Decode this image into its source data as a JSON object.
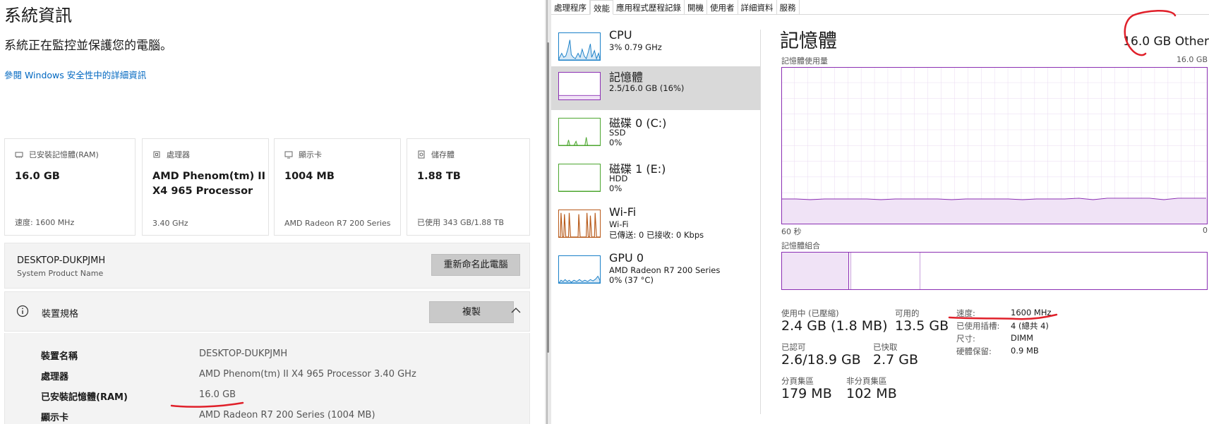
{
  "left": {
    "title": "系統資訊",
    "subtitle": "系統正在監控並保護您的電腦。",
    "link": "參閱 Windows 安全性中的詳細資訊",
    "cards": [
      {
        "icon": "ram-icon",
        "label": "已安裝記憶體(RAM)",
        "value": "16.0 GB",
        "value2": "",
        "footer": "速度: 1600 MHz"
      },
      {
        "icon": "processor-icon",
        "label": "處理器",
        "value": "AMD Phenom(tm) II",
        "value2": "X4 965 Processor",
        "footer": "3.40 GHz"
      },
      {
        "icon": "display-card-icon",
        "label": "顯示卡",
        "value": "1004 MB",
        "value2": "",
        "footer": "AMD Radeon R7 200 Series"
      },
      {
        "icon": "storage-icon",
        "label": "儲存體",
        "value": "1.88 TB",
        "value2": "",
        "footer": "已使用 343 GB/1.88 TB"
      }
    ],
    "device": {
      "name": "DESKTOP-DUKPJMH",
      "model": "System Product Name",
      "rename_button": "重新命名此電腦"
    },
    "specs": {
      "title": "裝置規格",
      "copy_button": "複製",
      "rows": [
        {
          "label": "裝置名稱",
          "value": "DESKTOP-DUKPJMH"
        },
        {
          "label": "處理器",
          "value": "AMD Phenom(tm) II X4 965 Processor   3.40 GHz"
        },
        {
          "label": "已安裝記憶體(RAM)",
          "value": "16.0 GB"
        },
        {
          "label": "顯示卡",
          "value": "AMD Radeon R7 200 Series (1004 MB)"
        }
      ]
    },
    "annotation_color": "#e0202a"
  },
  "taskmgr": {
    "tabs": [
      "處理程序",
      "效能",
      "應用程式歷程記錄",
      "開機",
      "使用者",
      "詳細資料",
      "服務"
    ],
    "active_tab": 1,
    "sidebar": [
      {
        "name": "CPU",
        "sub1": "3% 0.79 GHz",
        "sub2": "",
        "color": "#1a80c8"
      },
      {
        "name": "記憶體",
        "sub1": "2.5/16.0 GB (16%)",
        "sub2": "",
        "color": "#8b2fb3"
      },
      {
        "name": "磁碟 0 (C:)",
        "sub1": "SSD",
        "sub2": "0%",
        "color": "#4ca62f"
      },
      {
        "name": "磁碟 1 (E:)",
        "sub1": "HDD",
        "sub2": "0%",
        "color": "#4ca62f"
      },
      {
        "name": "Wi-Fi",
        "sub1": "Wi-Fi",
        "sub2": "已傳送: 0 已接收: 0 Kbps",
        "color": "#b85a1a"
      },
      {
        "name": "GPU 0",
        "sub1": "AMD Radeon R7 200 Series",
        "sub2": "0% (37 °C)",
        "color": "#1a80c8"
      }
    ],
    "selected_index": 1,
    "memory": {
      "title": "記憶體",
      "total_right": "16.0 GB Other",
      "usage_label": "記憶體使用量",
      "usage_max": "16.0 GB",
      "time_left": "60 秒",
      "time_right": "0",
      "composition_label": "記憶體組合",
      "in_use_label": "使用中 (已壓縮)",
      "in_use_value": "2.4 GB (1.8 MB)",
      "available_label": "可用的",
      "available_value": "13.5 GB",
      "committed_label": "已認可",
      "committed_value": "2.6/18.9 GB",
      "cached_label": "已快取",
      "cached_value": "2.7 GB",
      "paged_label": "分頁集區",
      "paged_value": "179 MB",
      "nonpaged_label": "非分頁集區",
      "nonpaged_value": "102 MB",
      "speed_label": "速度:",
      "speed_value": "1600 MHz",
      "slots_label": "已使用插槽:",
      "slots_value": "4 (總共 4)",
      "form_label": "尺寸:",
      "form_value": "DIMM",
      "reserved_label": "硬體保留:",
      "reserved_value": "0.9 MB",
      "usage_fraction": 0.16,
      "graph_color": "#8b2fb3"
    }
  }
}
